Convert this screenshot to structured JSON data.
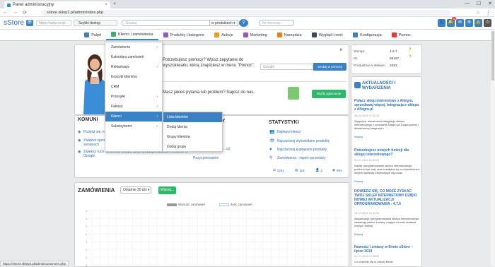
{
  "browser": {
    "tab_title": "Panel administracyjny",
    "tab_close": "×",
    "new_tab": "+",
    "window_controls": [
      "—",
      "☐",
      "✕"
    ],
    "nav_icons": [
      "←",
      "→",
      "⟳"
    ],
    "url": "sstore.sklep2.pl/admin/index.php",
    "right_icons": [
      "☆",
      "⋮"
    ],
    "status_url": "https://sstore.sklep2.pl/admin/customers.php"
  },
  "app": {
    "logo": "sStore",
    "eye_icon": "👁",
    "store_url": "https://www.moje...",
    "quick_access": "Szybki dostęp",
    "search_placeholder": "Szukaj",
    "search_scope": "w produktach ▾",
    "search_btn_icon": "⚲",
    "order_placeholder": "Nr zlecenia",
    "right_buttons": [
      {
        "icon": "👤",
        "badge": ""
      },
      {
        "icon": "🔔",
        "badge": "11"
      },
      {
        "icon": "✉",
        "badge": ""
      },
      {
        "icon": "⚙",
        "badge": ""
      },
      {
        "icon": "🔒",
        "badge": ""
      },
      {
        "icon": "⏻",
        "badge": ""
      }
    ]
  },
  "menu": {
    "items": [
      {
        "label": "Pulpit",
        "color": "#3b82c4",
        "active": false
      },
      {
        "label": "Klienci i zamówienia",
        "color": "#2fb86a",
        "active": true
      },
      {
        "label": "Produkty i kategorie",
        "color": "#8e5bc9",
        "active": false
      },
      {
        "label": "Aukcje",
        "color": "#f39c12",
        "active": false
      },
      {
        "label": "Marketing",
        "color": "#9b59b6",
        "active": false
      },
      {
        "label": "Narzędzia",
        "color": "#e67e22",
        "active": false
      },
      {
        "label": "Wygląd i treść",
        "color": "#34495e",
        "active": false
      },
      {
        "label": "Konfiguracja",
        "color": "#3b82c4",
        "active": false
      },
      {
        "label": "Pomoc",
        "color": "#e53935",
        "active": false
      }
    ]
  },
  "dropdown": {
    "items": [
      {
        "label": "Zamówienia",
        "chev": "›"
      },
      {
        "label": "Kalendarz zamówień",
        "chev": ""
      },
      {
        "label": "Reklamacje",
        "chev": "›"
      },
      {
        "label": "Koszyki klientów",
        "chev": ""
      },
      {
        "label": "CRM",
        "chev": ""
      },
      {
        "label": "Przesyłki",
        "chev": "›"
      },
      {
        "label": "Faktury",
        "chev": "›"
      },
      {
        "label": "Klienci",
        "chev": "›"
      },
      {
        "label": "Subskrybenci",
        "chev": "›"
      },
      {
        "label": "",
        "chev": ""
      },
      {
        "label": "",
        "chev": ""
      }
    ],
    "submenu": [
      "Lista klientów",
      "Dodaj klienta",
      "Grupy klientów",
      "Dodaj grupę"
    ]
  },
  "hero": {
    "close": "×",
    "help_q": "Potrzebujesz pomocy? Wpisz zapytanie do wyszukiwarki, którą znajdziesz w menu \"Pomoc\".",
    "help_placeholder": "Google",
    "help_btn": "Szukaj w pomocy",
    "idea_q": "Masz jakieś pytania lub problem? Napisz do nas.",
    "idea_btn": "Wyślij zgłoszenie"
  },
  "komunikaty": {
    "title": "KOMUNI",
    "links": [
      "Przejdź się, komunikat do sklepu",
      "Zwiększ sprzedaż w e-sklepie, promuj produkty w zewnętrznych serwisach",
      "Zwiększ ruch na stronie sklepu dzięki pozycjonowaniu i reklamie w Google."
    ],
    "cut_title": "LY",
    "poz_links": [
      "...cji",
      "Pozycjonowanie"
    ]
  },
  "statystyki": {
    "title": "STATYSTYKI",
    "links": [
      {
        "icon": "👥",
        "label": "Najlepsi klienci"
      },
      {
        "icon": "👁",
        "label": "Najczęściej wyświetlane produkty"
      },
      {
        "icon": "♥",
        "label": "Najczęściej kupowane produkty"
      },
      {
        "icon": "⚲",
        "label": "Zamówienia - raport sprzedaży"
      }
    ],
    "counts": [
      {
        "icon": "⛁",
        "value": "2291"
      },
      {
        "icon": "▤",
        "value": "118"
      },
      {
        "icon": "👤",
        "value": "2"
      },
      {
        "icon": "◉",
        "value": "994"
      }
    ]
  },
  "orders": {
    "title": "ZAMÓWIENIA",
    "range": "Ostatnie 30 dni ▾",
    "btn": "Więcej...",
    "legend": [
      {
        "label": "Wartość zamówień",
        "color": "#999999"
      },
      {
        "label": "Ilość zamówień",
        "color": "#a9c7ee"
      }
    ]
  },
  "side": {
    "rows": [
      {
        "label": "Wersja:",
        "value": "4.6.7"
      },
      {
        "label": "ID:",
        "value": "69197"
      },
      {
        "label": "Produktów w sklepie:",
        "value": "2291"
      }
    ],
    "q": "?"
  },
  "news": {
    "title": "AKTUALNOŚCI I WYDARZENIA",
    "items": [
      {
        "title": "Połącz sklep internetowy z Allegro, sprzedawaj więcej. Integracja e-sklepu z Allegro.pl",
        "date": "25-09-2019 07:42:25",
        "body": "Wygodna, dwustronna integracja sklepu internetowego z serwisem Allegro.pl! Dzięki pełnej i dwustronnej integracji z",
        "more": "Więcej"
      },
      {
        "title": "Potrzebujesz nowych funkcji dla sklepu internetowego?",
        "date": "20-07-2019 15:44:03",
        "body": "Każde oprogramowanie sklepu internetowego powinno być cały czas rozwijane by w odpowiednim stopniu spełniać zmieniające się coraz",
        "more": "Więcej"
      },
      {
        "title": "DOWIEDZ SIĘ, CO MOŻE ZYSKAĆ TWÓJ SKLEP INTERNETOWY DZIĘKI NOWEJ AKTUALIZACJI OPROGRAMOWANIA - 4.7.6",
        "date": "19-07-2019 10:42:33",
        "body": "Aktualizacje oprogramowania sklepu internetowego zawierają ważne zmiany, mające na celu dodanie nowych funkcji",
        "more": "Więcej"
      },
      {
        "title": "Nowości i zmiany w firmie sStore – lipiec 2019",
        "date": "02-07-2019 07:38:09",
        "body": "Co zmieniło się w naszej firmie",
        "more": ""
      }
    ]
  }
}
